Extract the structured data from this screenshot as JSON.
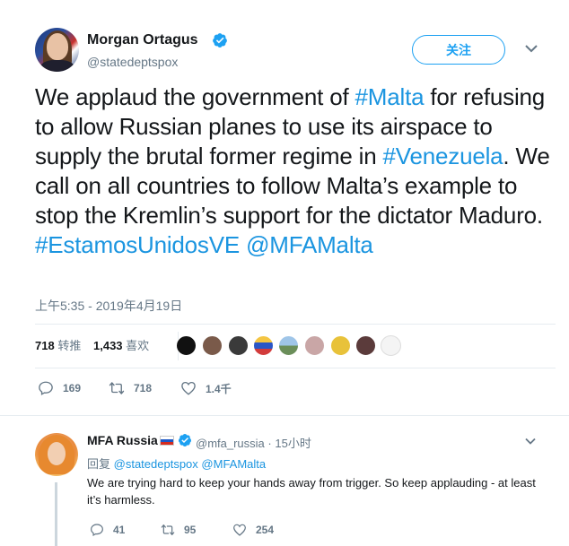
{
  "tweet": {
    "author_name": "Morgan Ortagus",
    "author_handle": "@statedeptspox",
    "follow_label": "关注",
    "text_segments": [
      {
        "text": "We applaud the government of ",
        "link": false
      },
      {
        "text": "#Malta",
        "link": true
      },
      {
        "text": " for refusing to allow Russian planes to use its airspace to supply the brutal former regime in ",
        "link": false
      },
      {
        "text": "#Venezuela",
        "link": true
      },
      {
        "text": ". We call on all countries to follow Malta’s example to stop the Kremlin’s support for the dictator Maduro. ",
        "link": false
      },
      {
        "text": "#EstamosUnidosVE",
        "link": true
      },
      {
        "text": " ",
        "link": false
      },
      {
        "text": "@MFAMalta",
        "link": true
      }
    ],
    "timestamp": "上午5:35 - 2019年4月19日",
    "retweets_count": "718",
    "retweets_label": "转推",
    "likes_count": "1,433",
    "likes_label": "喜欢",
    "replies": "169",
    "retweets": "718",
    "likes": "1.4千"
  },
  "reply": {
    "author_name": "MFA Russia",
    "author_handle": "@mfa_russia",
    "time": "15小时",
    "separator": "·",
    "reply_prefix": "回复",
    "reply_to_1": "@statedeptspox",
    "reply_to_2": "@MFAMalta",
    "text": "We are trying hard to keep your hands away from trigger. So keep applauding - at least it’s harmless.",
    "replies": "41",
    "retweets": "95",
    "likes": "254"
  },
  "colors": {
    "link": "#1b95e0",
    "muted": "#657786",
    "follow": "#1da1f2",
    "divider": "#e6ecf0"
  },
  "icons": [
    "verified-icon",
    "chevron-down-icon",
    "reply-icon",
    "retweet-icon",
    "like-icon",
    "russian-flag-icon"
  ]
}
